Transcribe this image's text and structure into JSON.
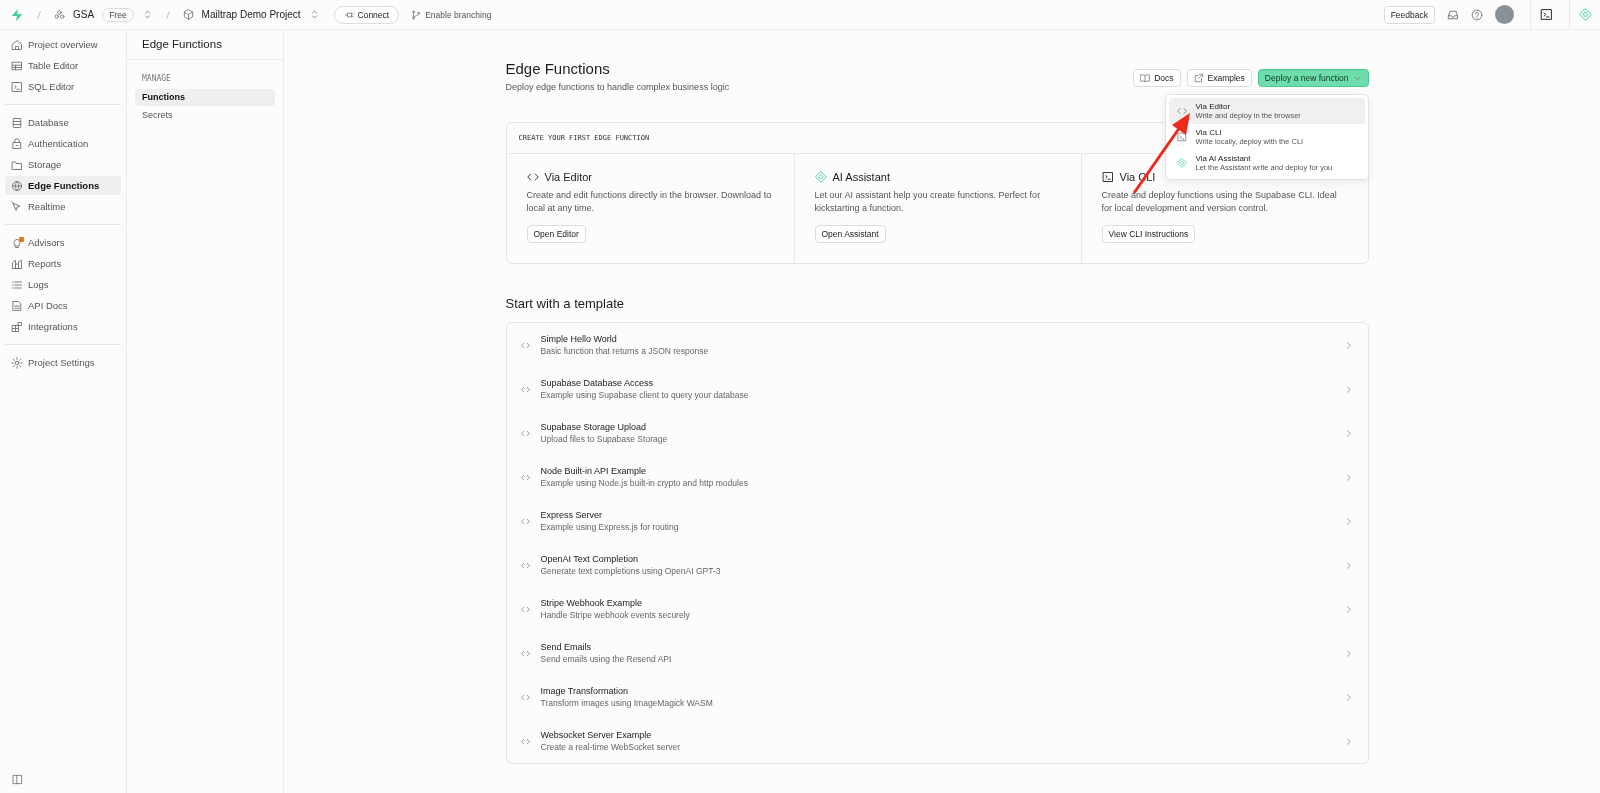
{
  "top_bar": {
    "org": {
      "name": "GSA",
      "plan": "Free"
    },
    "project": {
      "name": "Mailtrap Demo Project"
    },
    "connect_button": "Connect",
    "branching_link": "Enable branching",
    "feedback_button": "Feedback"
  },
  "nav": {
    "groups": [
      {
        "items": [
          {
            "label": "Project overview",
            "selected": false,
            "alert": false
          },
          {
            "label": "Table Editor",
            "selected": false,
            "alert": false
          },
          {
            "label": "SQL Editor",
            "selected": false,
            "alert": false
          }
        ]
      },
      {
        "items": [
          {
            "label": "Database",
            "selected": false,
            "alert": false
          },
          {
            "label": "Authentication",
            "selected": false,
            "alert": false
          },
          {
            "label": "Storage",
            "selected": false,
            "alert": false
          },
          {
            "label": "Edge Functions",
            "selected": true,
            "alert": false
          },
          {
            "label": "Realtime",
            "selected": false,
            "alert": false
          }
        ]
      },
      {
        "items": [
          {
            "label": "Advisors",
            "selected": false,
            "alert": true
          },
          {
            "label": "Reports",
            "selected": false,
            "alert": false
          },
          {
            "label": "Logs",
            "selected": false,
            "alert": false
          },
          {
            "label": "API Docs",
            "selected": false,
            "alert": false
          },
          {
            "label": "Integrations",
            "selected": false,
            "alert": false
          }
        ]
      },
      {
        "items": [
          {
            "label": "Project Settings",
            "selected": false,
            "alert": false
          }
        ]
      }
    ]
  },
  "submenu": {
    "title": "Edge Functions",
    "section": "MANAGE",
    "items": [
      {
        "label": "Functions",
        "selected": true
      },
      {
        "label": "Secrets",
        "selected": false
      }
    ]
  },
  "page": {
    "title": "Edge Functions",
    "subtitle": "Deploy edge functions to handle complex business logic",
    "buttons": [
      "Docs",
      "Examples"
    ],
    "primary_button": "Deploy a new function"
  },
  "deploy_menu": {
    "items": [
      {
        "title": "Via Editor",
        "description": "Write and deploy in the browser",
        "selected": true
      },
      {
        "title": "Via CLI",
        "description": "Write locally, deploy with the CLI",
        "selected": false
      },
      {
        "title": "Via AI Assistant",
        "description": "Let the Assistant write and deploy for you",
        "selected": false
      }
    ]
  },
  "create_card": {
    "heading": "CREATE YOUR FIRST EDGE FUNCTION",
    "options": [
      {
        "title": "Via Editor",
        "description": "Create and edit functions directly in the browser. Download to local at any time.",
        "button": "Open Editor"
      },
      {
        "title": "AI Assistant",
        "description": "Let our AI assistant help you create functions. Perfect for kickstarting a function.",
        "button": "Open Assistant"
      },
      {
        "title": "Via CLI",
        "description": "Create and deploy functions using the Supabase CLI. Ideal for local development and version control.",
        "button": "View CLI Instructions"
      }
    ]
  },
  "templates": {
    "title": "Start with a template",
    "items": [
      {
        "title": "Simple Hello World",
        "description": "Basic function that returns a JSON response"
      },
      {
        "title": "Supabase Database Access",
        "description": "Example using Supabase client to query your database"
      },
      {
        "title": "Supabase Storage Upload",
        "description": "Upload files to Supabase Storage"
      },
      {
        "title": "Node Built-in API Example",
        "description": "Example using Node.js built-in crypto and http modules"
      },
      {
        "title": "Express Server",
        "description": "Example using Express.js for routing"
      },
      {
        "title": "OpenAI Text Completion",
        "description": "Generate text completions using OpenAI GPT-3"
      },
      {
        "title": "Stripe Webhook Example",
        "description": "Handle Stripe webhook events securely"
      },
      {
        "title": "Send Emails",
        "description": "Send emails using the Resend API"
      },
      {
        "title": "Image Transformation",
        "description": "Transform images using ImageMagick WASM"
      },
      {
        "title": "Websocket Server Example",
        "description": "Create a real-time WebSocket server"
      }
    ]
  }
}
